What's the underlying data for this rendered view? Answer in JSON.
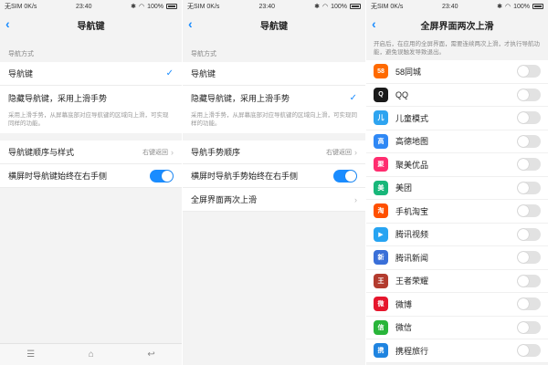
{
  "status": {
    "carrier": "无SIM 0K/s",
    "time": "23:40",
    "battery": "100%",
    "bt_icon": "bluetooth-icon",
    "wifi_icon": "wifi-icon"
  },
  "screen1": {
    "title": "导航键",
    "section_header": "导航方式",
    "option1": "导航键",
    "option2": "隐藏导航键，采用上滑手势",
    "option2_desc": "采用上滑手势，从屏幕底部对应导航键的区域向上滑，可实现同样的功能。",
    "order_label": "导航键顺序与样式",
    "order_value": "右键返回",
    "landscape_label": "横屏时导航键始终在右手侧",
    "landscape_on": true,
    "navbar": {
      "menu": "☰",
      "home": "⌂",
      "back": "↩"
    }
  },
  "screen2": {
    "title": "导航键",
    "section_header": "导航方式",
    "option1": "导航键",
    "option2": "隐藏导航键，采用上滑手势",
    "option2_desc": "采用上滑手势，从屏幕底部对应导航键的区域向上滑，可实现同样的功能。",
    "order_label": "导航手势顺序",
    "order_value": "右键返回",
    "landscape_label": "横屏时导航手势始终在右手侧",
    "landscape_on": true,
    "fullscreen_label": "全屏界面两次上滑"
  },
  "screen3": {
    "title": "全屏界面两次上滑",
    "intro": "开启后，在应用的全屏界面，需要连续两次上滑，才执行导航功能，避免误触发导致退出。",
    "apps": [
      {
        "name": "58同城",
        "icon": "58",
        "color": "#ff6a00",
        "on": false
      },
      {
        "name": "QQ",
        "icon": "Q",
        "color": "#1a1a1a",
        "on": false
      },
      {
        "name": "儿童模式",
        "icon": "儿",
        "color": "#2ea4f0",
        "on": false
      },
      {
        "name": "高德地图",
        "icon": "高",
        "color": "#2f88f5",
        "on": false
      },
      {
        "name": "聚美优品",
        "icon": "聚",
        "color": "#ff2d6f",
        "on": false
      },
      {
        "name": "美团",
        "icon": "美",
        "color": "#18b77a",
        "on": false
      },
      {
        "name": "手机淘宝",
        "icon": "淘",
        "color": "#ff5000",
        "on": false
      },
      {
        "name": "腾讯视频",
        "icon": "▶",
        "color": "#27a4f2",
        "on": false
      },
      {
        "name": "腾讯新闻",
        "icon": "新",
        "color": "#3a6fd8",
        "on": false
      },
      {
        "name": "王者荣耀",
        "icon": "王",
        "color": "#b33b2e",
        "on": false
      },
      {
        "name": "微博",
        "icon": "微",
        "color": "#e6162d",
        "on": false
      },
      {
        "name": "微信",
        "icon": "信",
        "color": "#29b53a",
        "on": false
      },
      {
        "name": "携程旅行",
        "icon": "携",
        "color": "#1f84e0",
        "on": false
      }
    ]
  }
}
